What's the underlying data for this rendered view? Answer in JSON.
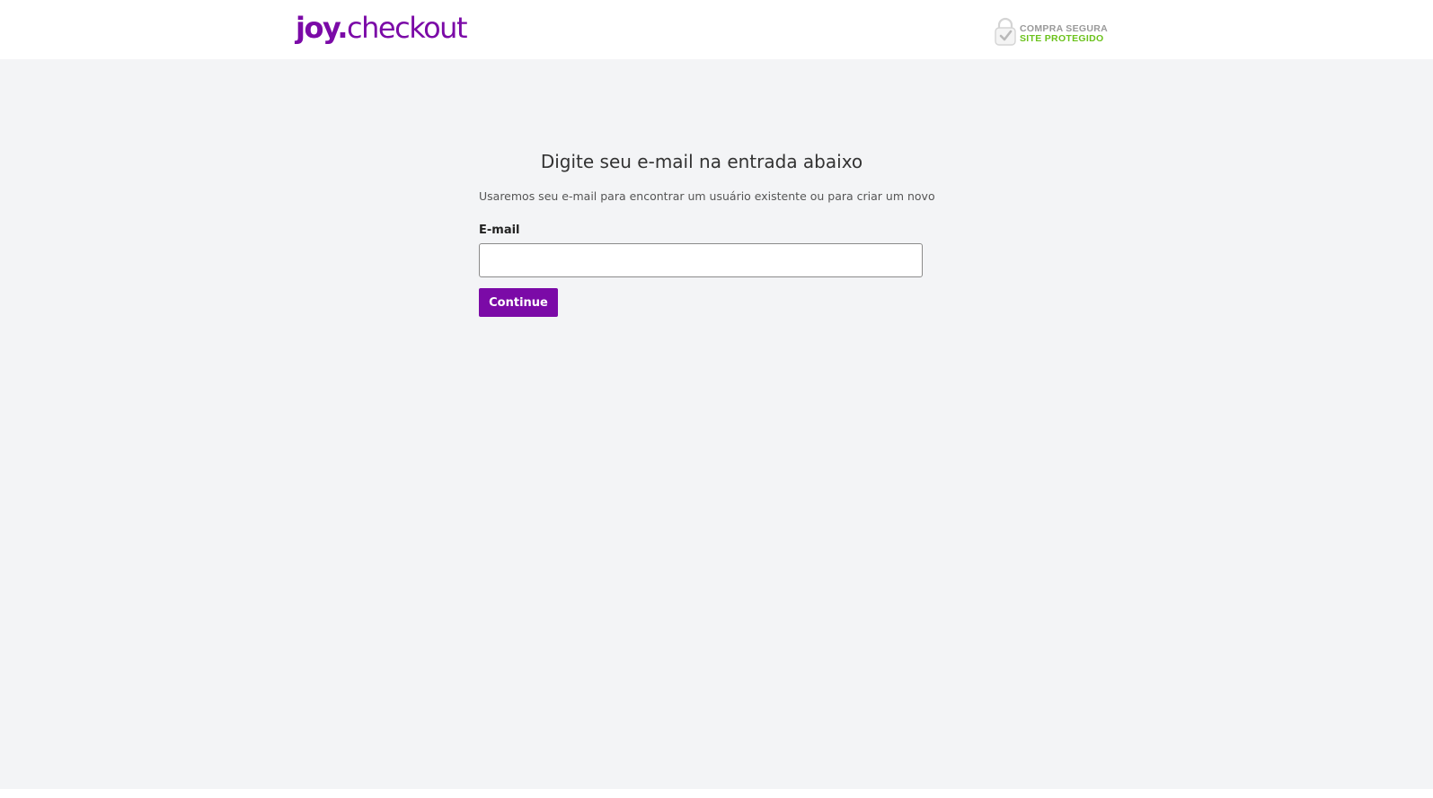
{
  "header": {
    "logo": {
      "part1": "joy",
      "part2": ".",
      "part3": "checkout"
    },
    "seal": {
      "line1": "COMPRA SEGURA",
      "line2": "SITE PROTEGIDO",
      "icon": "lock-check-icon"
    }
  },
  "main": {
    "title": "Digite seu e-mail na entrada abaixo",
    "subtitle": "Usaremos seu e-mail para encontrar um usuário existente ou para criar um novo",
    "email_label": "E-mail",
    "email_value": "",
    "email_placeholder": "",
    "continue_label": "Continue"
  },
  "colors": {
    "brand": "#7b0aa7",
    "background": "#f3f4f6",
    "seal_gray": "#9a9a9a",
    "seal_green": "#6bc21c"
  }
}
